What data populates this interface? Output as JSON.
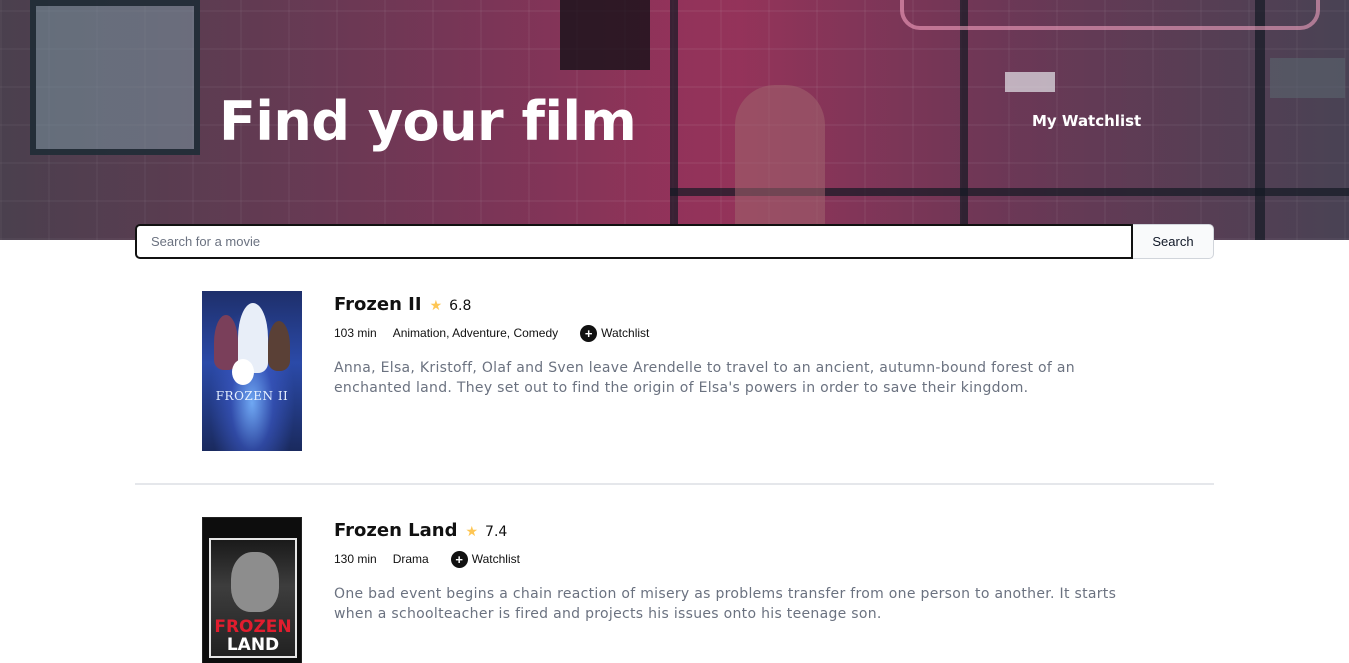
{
  "hero": {
    "title": "Find your film",
    "watchlist_link": "My Watchlist"
  },
  "search": {
    "placeholder": "Search for a movie",
    "value": "",
    "button_label": "Search"
  },
  "movies": [
    {
      "poster_title": "FROZEN II",
      "title": "Frozen II",
      "rating": "6.8",
      "runtime": "103 min",
      "genres": "Animation, Adventure, Comedy",
      "watchlist_label": "Watchlist",
      "plot": "Anna, Elsa, Kristoff, Olaf and Sven leave Arendelle to travel to an ancient, autumn-bound forest of an enchanted land. They set out to find the origin of Elsa's powers in order to save their kingdom."
    },
    {
      "poster_title_line1": "FROZEN",
      "poster_title_line2": "LAND",
      "title": "Frozen Land",
      "rating": "7.4",
      "runtime": "130 min",
      "genres": "Drama",
      "watchlist_label": "Watchlist",
      "plot": "One bad event begins a chain reaction of misery as problems transfer from one person to another. It starts when a schoolteacher is fired and projects his issues onto his teenage son."
    }
  ],
  "icons": {
    "star": "star-icon",
    "add": "plus-circle-icon"
  },
  "colors": {
    "star": "#fec654",
    "plot_text": "#6b7280",
    "accent_dark": "#111111"
  }
}
